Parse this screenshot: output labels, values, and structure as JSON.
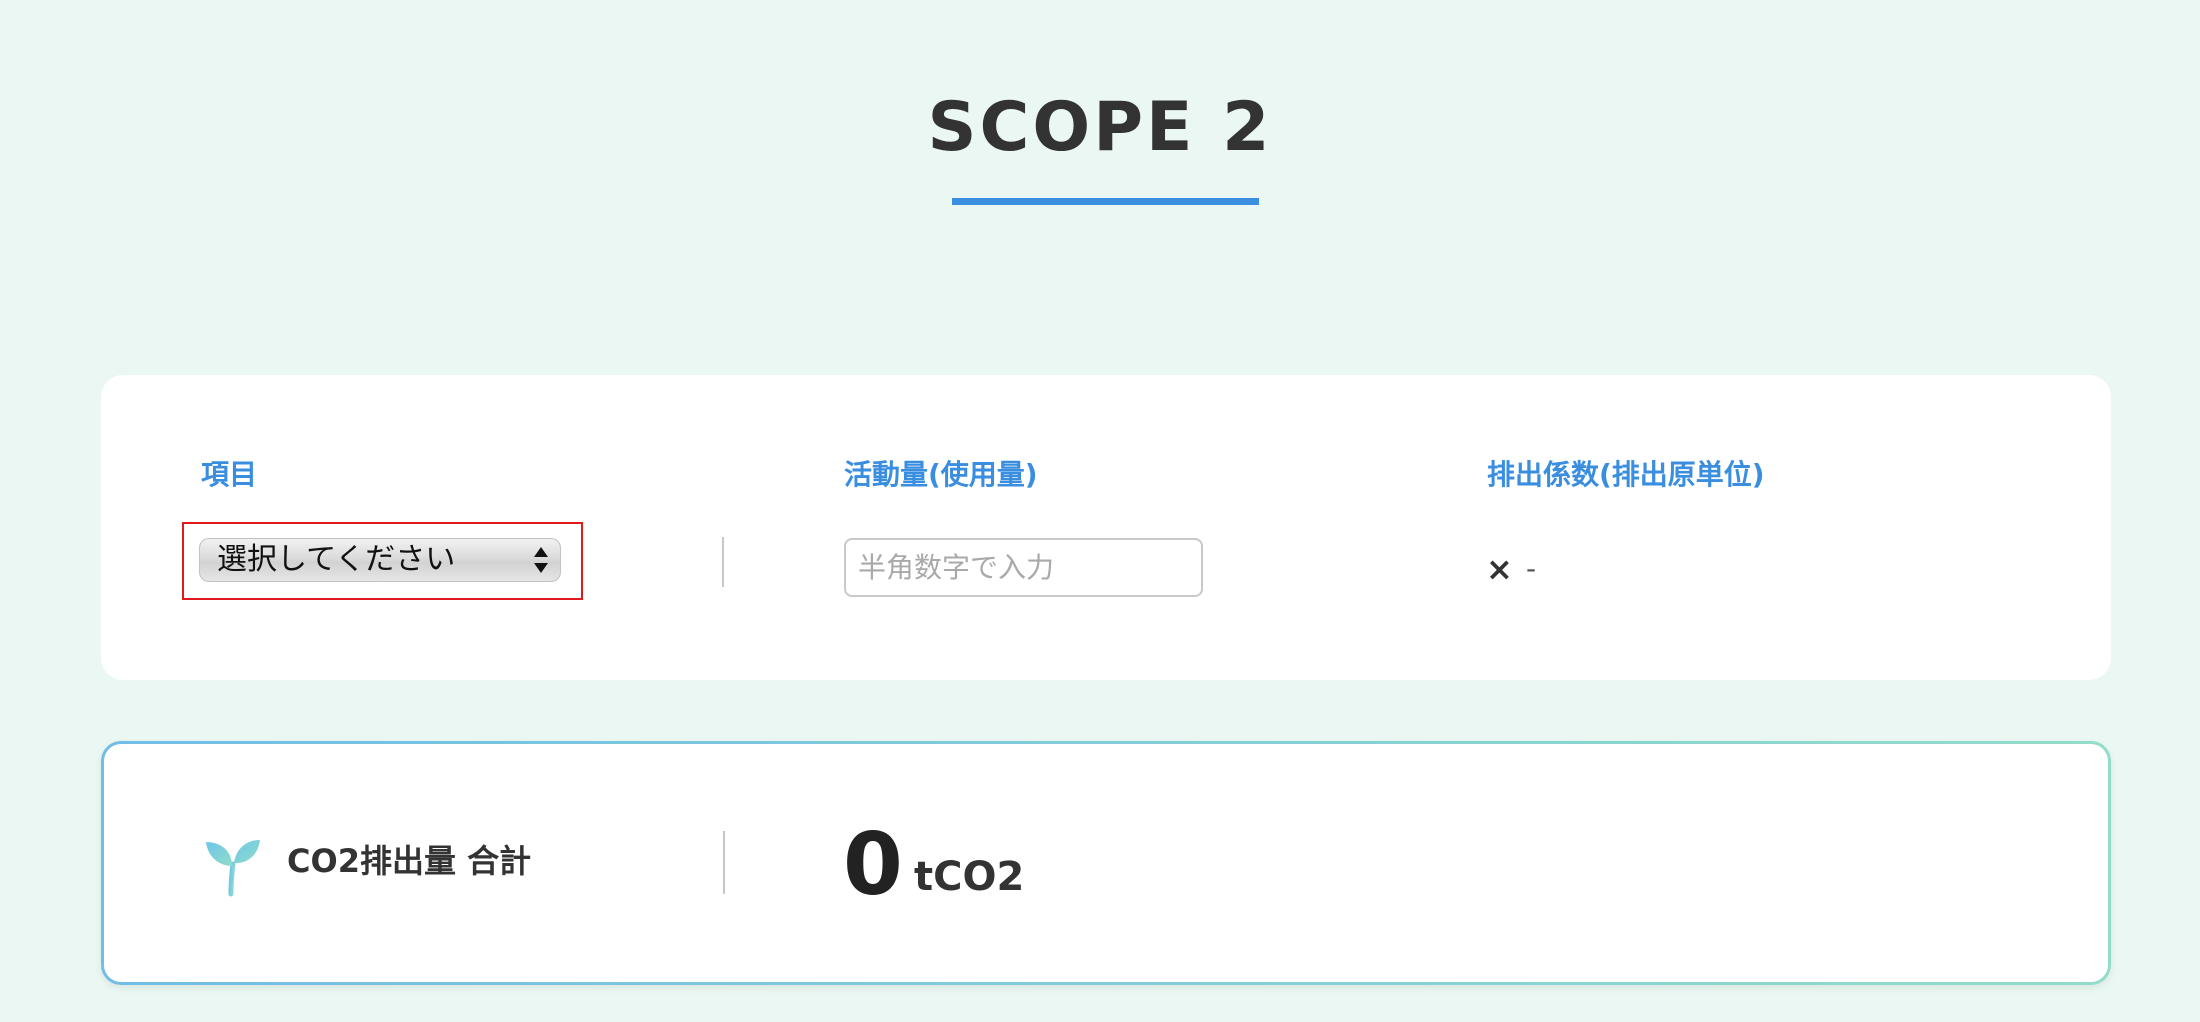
{
  "page": {
    "title": "SCOPE 2"
  },
  "input_card": {
    "columns": [
      {
        "label": "項目"
      },
      {
        "label": "活動量(使用量)"
      },
      {
        "label": "排出係数(排出原単位)"
      }
    ],
    "item_select": {
      "selected": "選択してください"
    },
    "amount_input": {
      "value": "",
      "placeholder": "半角数字で入力"
    },
    "factor": {
      "operator": "×",
      "value": "-"
    }
  },
  "total_card": {
    "icon": "sprout-icon",
    "label": "CO2排出量 合計",
    "value": "0",
    "unit": "tCO2"
  },
  "colors": {
    "background": "#eaf7f2",
    "accent_blue": "#3b8ee0",
    "highlight_red": "#e01a1a",
    "border_gradient_start": "#72bde6",
    "border_gradient_end": "#92dcc9"
  }
}
